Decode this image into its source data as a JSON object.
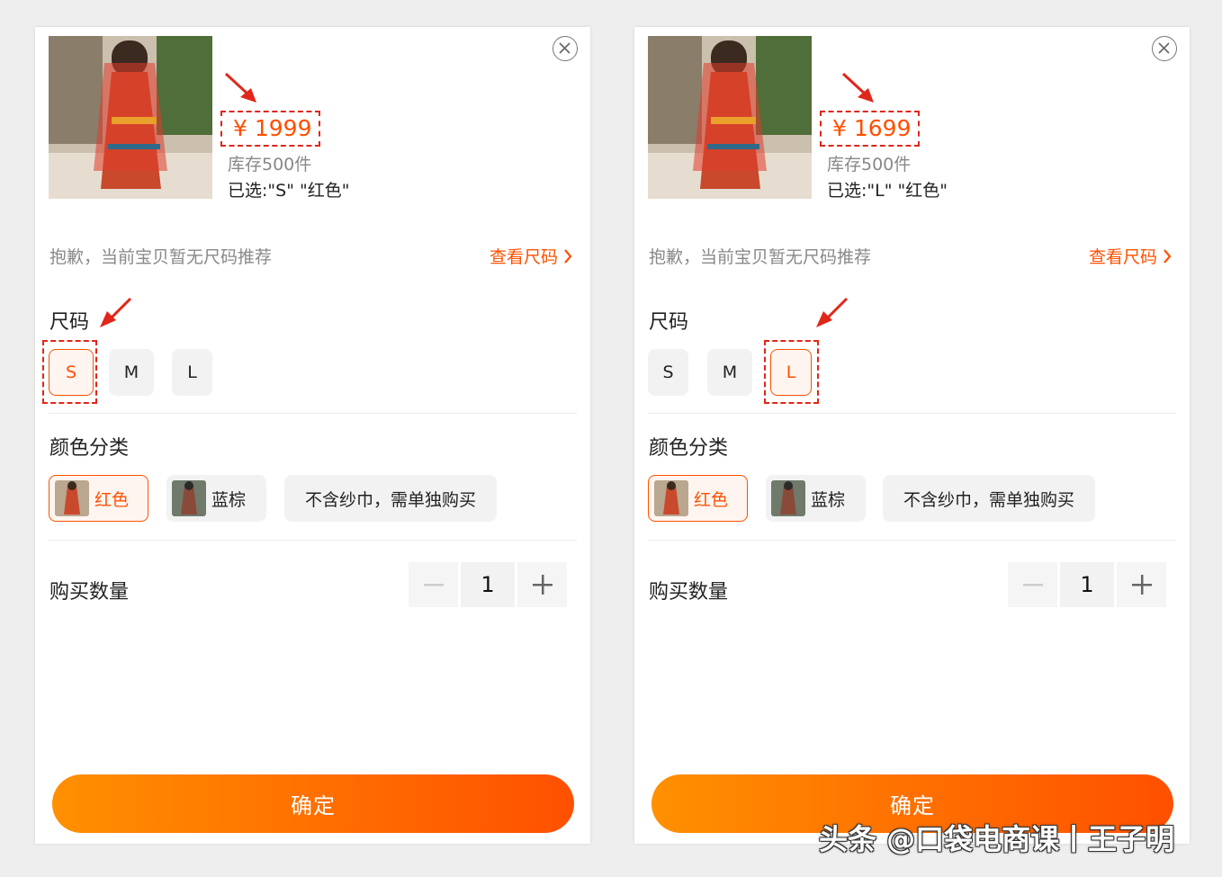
{
  "panels": [
    {
      "price": "¥ 1999",
      "stock": "库存500件",
      "selected": "已选:\"S\" \"红色\"",
      "notice": "抱歉，当前宝贝暂无尺码推荐",
      "size_chart_link": "查看尺码",
      "size_title": "尺码",
      "sizes": [
        "S",
        "M",
        "L"
      ],
      "active_size_index": 0,
      "color_title": "颜色分类",
      "colors": [
        "红色",
        "蓝棕",
        "不含纱巾，需单独购买"
      ],
      "active_color_index": 0,
      "qty_title": "购买数量",
      "quantity": "1",
      "confirm": "确定"
    },
    {
      "price": "¥ 1699",
      "stock": "库存500件",
      "selected": "已选:\"L\" \"红色\"",
      "notice": "抱歉，当前宝贝暂无尺码推荐",
      "size_chart_link": "查看尺码",
      "size_title": "尺码",
      "sizes": [
        "S",
        "M",
        "L"
      ],
      "active_size_index": 2,
      "color_title": "颜色分类",
      "colors": [
        "红色",
        "蓝棕",
        "不含纱巾，需单独购买"
      ],
      "active_color_index": 0,
      "qty_title": "购买数量",
      "quantity": "1",
      "confirm": "确定"
    }
  ],
  "watermark": "头条 @口袋电商课丨王子明",
  "colors_theme": {
    "accent": "#ff5000",
    "annotation_red": "#e0261a"
  },
  "icons": [
    "close-icon",
    "chevron-right-icon",
    "minus-icon",
    "plus-icon",
    "arrow-annotation-icon"
  ]
}
